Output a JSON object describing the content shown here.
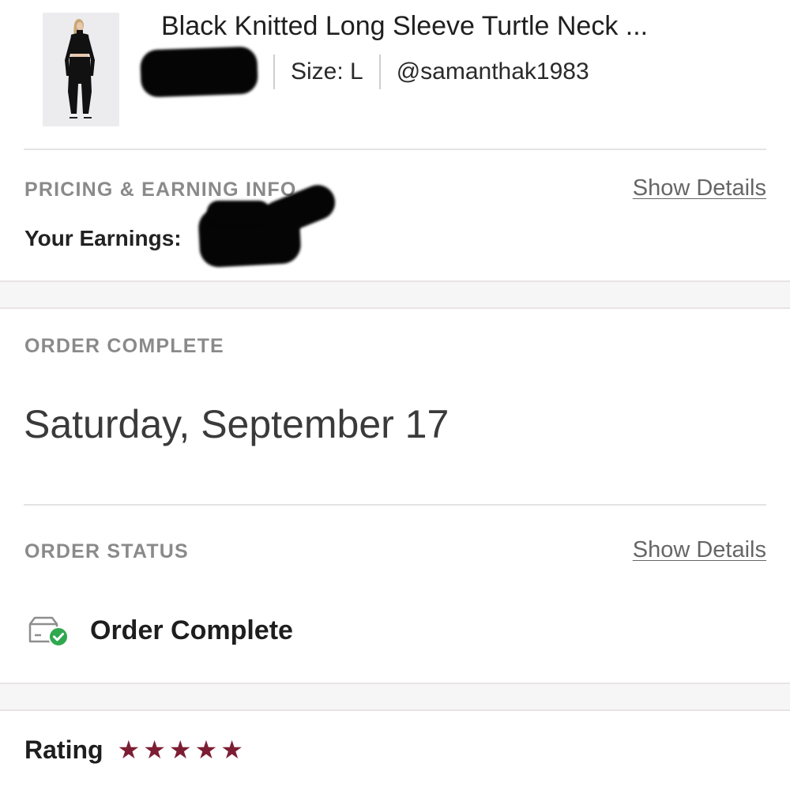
{
  "product": {
    "title": "Black Knitted Long Sleeve Turtle Neck ...",
    "size": "Size: L",
    "seller": "@samanthak1983"
  },
  "pricing": {
    "section_label": "PRICING & EARNING INFO",
    "show_details": "Show Details",
    "earnings_label": "Your Earnings:"
  },
  "order_complete": {
    "section_label": "ORDER COMPLETE",
    "date": "Saturday, September 17"
  },
  "order_status": {
    "section_label": "ORDER STATUS",
    "show_details": "Show Details",
    "status_text": "Order Complete",
    "status_icon": "package-check-icon"
  },
  "rating": {
    "label": "Rating",
    "stars": 5,
    "star_char": "★",
    "star_color": "#7d1d33"
  },
  "colors": {
    "accent_check": "#2fa84f",
    "label_gray": "#8a8a8a",
    "link_gray": "#666666"
  }
}
